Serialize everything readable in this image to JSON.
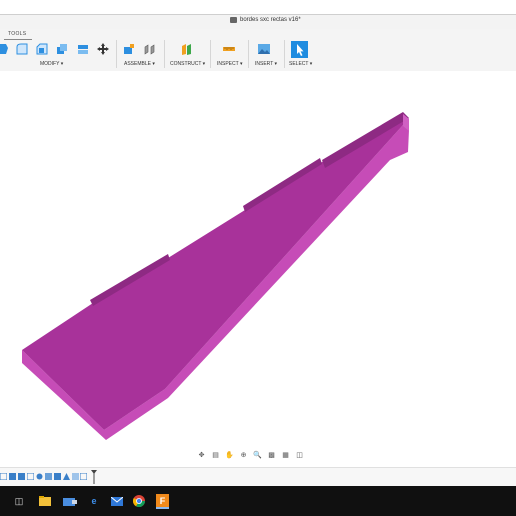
{
  "window": {
    "title": "bordes sxc rectas v16*"
  },
  "toolbar": {
    "tab_label": "TOOLS",
    "groups": {
      "modify": "MODIFY ▾",
      "assemble": "ASSEMBLE ▾",
      "construct": "CONSTRUCT ▾",
      "inspect": "INSPECT ▾",
      "insert": "INSERT ▾",
      "select": "SELECT ▾"
    }
  },
  "model": {
    "color_top": "#a8329a",
    "color_side": "#c64cb7",
    "color_ridge": "#8e2a83"
  },
  "taskbar": {
    "edge_glyph": "e",
    "fusion_glyph": "F"
  }
}
